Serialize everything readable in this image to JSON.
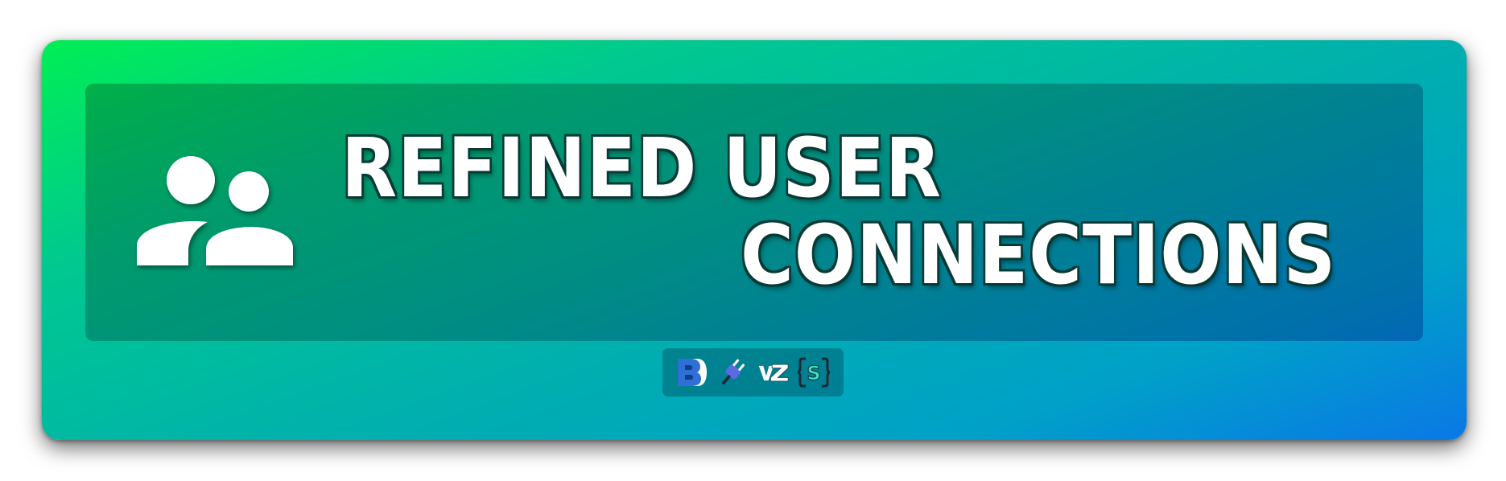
{
  "title": {
    "line1": "REFINED USER",
    "line2": "CONNECTIONS"
  },
  "icons": {
    "main": "users-icon",
    "badges": [
      "betterdiscord-icon",
      "plug-icon",
      "vz-icon",
      "s-bracket-icon"
    ]
  },
  "badges": {
    "vz_text": "VZ",
    "s_text": "S"
  },
  "colors": {
    "gradient_start": "#00ee55",
    "gradient_end": "#0a78e6",
    "title_text": "#ffffff",
    "title_outline": "#073a35"
  }
}
